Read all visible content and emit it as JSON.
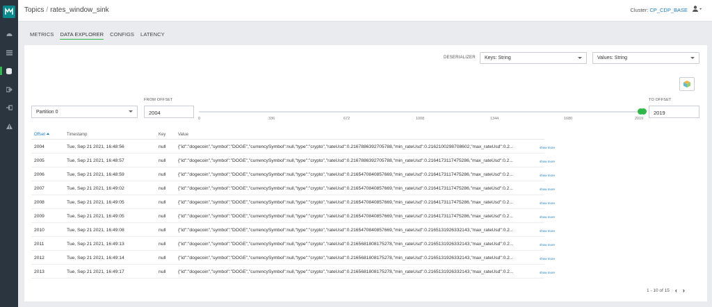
{
  "header": {
    "breadcrumb_root": "Topics",
    "breadcrumb_sep": "/",
    "topic_name": "rates_window_sink",
    "cluster_label": "Cluster:",
    "cluster_name": "CP_CDP_BASE"
  },
  "tabs": [
    {
      "label": "METRICS"
    },
    {
      "label": "DATA EXPLORER"
    },
    {
      "label": "CONFIGS"
    },
    {
      "label": "LATENCY"
    }
  ],
  "deserializer": {
    "label": "DESERIALIZER",
    "keys_value": "Keys: String",
    "values_value": "Values: String"
  },
  "partition": {
    "value": "Partition 0"
  },
  "offsets": {
    "from_label": "FROM OFFSET",
    "from_value": "2004",
    "to_label": "TO OFFSET",
    "to_value": "2019",
    "ticks": [
      "0",
      "336",
      "672",
      "1008",
      "1344",
      "1680",
      "2019"
    ]
  },
  "table": {
    "columns": [
      "Offset",
      "Timestamp",
      "Key",
      "Value"
    ],
    "more_label": "show more",
    "rows": [
      {
        "offset": "2004",
        "timestamp": "Tue, Sep 21 2021, 16:48:56",
        "key": "null",
        "value": "{\"id\":\"dogecoin\",\"symbol\":\"DOGE\",\"currencySymbol\":null,\"type\":\"crypto\",\"rateUsd\":0.2167886392705788,\"min_rateUsd\":0.2162100298708602,\"max_rateUsd\":0.2..."
      },
      {
        "offset": "2005",
        "timestamp": "Tue, Sep 21 2021, 16:48:57",
        "key": "null",
        "value": "{\"id\":\"dogecoin\",\"symbol\":\"DOGE\",\"currencySymbol\":null,\"type\":\"crypto\",\"rateUsd\":0.2167886392705788,\"min_rateUsd\":0.2164173117475286,\"max_rateUsd\":0.2..."
      },
      {
        "offset": "2006",
        "timestamp": "Tue, Sep 21 2021, 16:48:59",
        "key": "null",
        "value": "{\"id\":\"dogecoin\",\"symbol\":\"DOGE\",\"currencySymbol\":null,\"type\":\"crypto\",\"rateUsd\":0.2165470840857669,\"min_rateUsd\":0.2164173117475286,\"max_rateUsd\":0.2..."
      },
      {
        "offset": "2007",
        "timestamp": "Tue, Sep 21 2021, 16:49:02",
        "key": "null",
        "value": "{\"id\":\"dogecoin\",\"symbol\":\"DOGE\",\"currencySymbol\":null,\"type\":\"crypto\",\"rateUsd\":0.2165470840857669,\"min_rateUsd\":0.2164173117475286,\"max_rateUsd\":0.2..."
      },
      {
        "offset": "2008",
        "timestamp": "Tue, Sep 21 2021, 16:49:05",
        "key": "null",
        "value": "{\"id\":\"dogecoin\",\"symbol\":\"DOGE\",\"currencySymbol\":null,\"type\":\"crypto\",\"rateUsd\":0.2165470840857669,\"min_rateUsd\":0.2164173117475286,\"max_rateUsd\":0.2..."
      },
      {
        "offset": "2009",
        "timestamp": "Tue, Sep 21 2021, 16:49:05",
        "key": "null",
        "value": "{\"id\":\"dogecoin\",\"symbol\":\"DOGE\",\"currencySymbol\":null,\"type\":\"crypto\",\"rateUsd\":0.2165470840857669,\"min_rateUsd\":0.2164173117475286,\"max_rateUsd\":0.2..."
      },
      {
        "offset": "2010",
        "timestamp": "Tue, Sep 21 2021, 16:49:08",
        "key": "null",
        "value": "{\"id\":\"dogecoin\",\"symbol\":\"DOGE\",\"currencySymbol\":null,\"type\":\"crypto\",\"rateUsd\":0.2165470840857669,\"min_rateUsd\":0.2165131926332143,\"max_rateUsd\":0.2..."
      },
      {
        "offset": "2011",
        "timestamp": "Tue, Sep 21 2021, 16:49:13",
        "key": "null",
        "value": "{\"id\":\"dogecoin\",\"symbol\":\"DOGE\",\"currencySymbol\":null,\"type\":\"crypto\",\"rateUsd\":0.2165681808175278,\"min_rateUsd\":0.2165131926332143,\"max_rateUsd\":0.2..."
      },
      {
        "offset": "2012",
        "timestamp": "Tue, Sep 21 2021, 16:49:14",
        "key": "null",
        "value": "{\"id\":\"dogecoin\",\"symbol\":\"DOGE\",\"currencySymbol\":null,\"type\":\"crypto\",\"rateUsd\":0.2165681808175278,\"min_rateUsd\":0.2165131926332143,\"max_rateUsd\":0.2..."
      },
      {
        "offset": "2013",
        "timestamp": "Tue, Sep 21 2021, 16:49:17",
        "key": "null",
        "value": "{\"id\":\"dogecoin\",\"symbol\":\"DOGE\",\"currencySymbol\":null,\"type\":\"crypto\",\"rateUsd\":0.2165681808175278,\"min_rateUsd\":0.2165131926332143,\"max_rateUsd\":0.2..."
      }
    ]
  },
  "pagination": {
    "label": "1 - 10 of 15"
  },
  "icons": {
    "logo": "app-logo-icon",
    "nav": [
      "dashboard-icon",
      "list-icon",
      "database-icon",
      "export-icon",
      "import-icon",
      "warning-icon"
    ],
    "user": "user-icon",
    "cube": "cube-icon"
  },
  "colors": {
    "accent": "#2fb84a",
    "link": "#1a7fc1",
    "rail": "#2b3540",
    "logo": "#0a8a8a"
  }
}
